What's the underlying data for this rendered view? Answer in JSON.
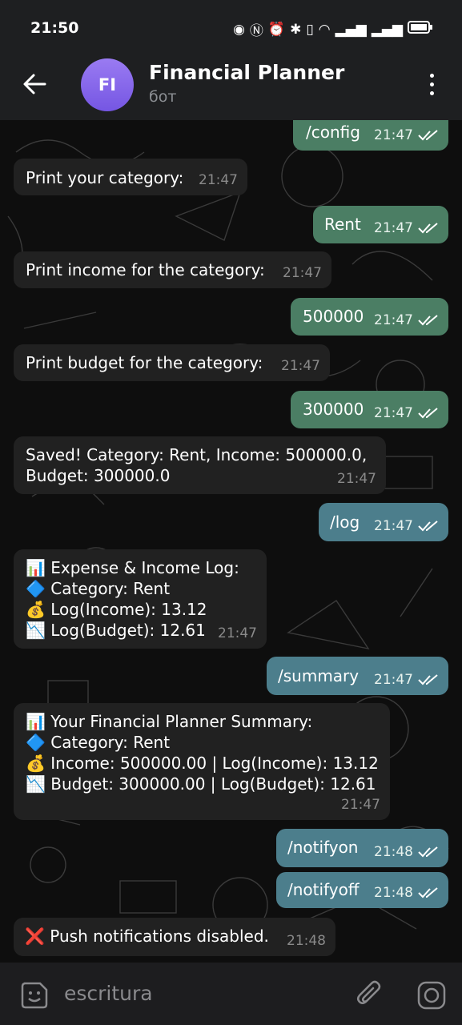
{
  "status_bar": {
    "time": "21:50"
  },
  "header": {
    "avatar_initials": "FI",
    "title": "Financial Planner",
    "subtitle": "бот"
  },
  "messages": [
    {
      "text": "/config",
      "time": "21:47"
    },
    {
      "text": "Print your category:",
      "time": "21:47"
    },
    {
      "text": "Rent",
      "time": "21:47"
    },
    {
      "text": "Print income for the category:",
      "time": "21:47"
    },
    {
      "text": "500000",
      "time": "21:47"
    },
    {
      "text": "Print budget for the category:",
      "time": "21:47"
    },
    {
      "text": "300000",
      "time": "21:47"
    },
    {
      "text": "Saved! Category: Rent, Income: 500000.0,\nBudget: 300000.0",
      "time": "21:47"
    },
    {
      "text": "/log",
      "time": "21:47"
    },
    {
      "text": "📊 Expense & Income Log:\n🔷 Category: Rent\n💰 Log(Income): 13.12\n📉 Log(Budget): 12.61",
      "time": "21:47"
    },
    {
      "text": "/summary",
      "time": "21:47"
    },
    {
      "text": "📊 Your Financial Planner Summary:\n🔷 Category: Rent\n💰 Income: 500000.00 | Log(Income): 13.12\n📉 Budget: 300000.00 | Log(Budget): 12.61",
      "time": "21:47"
    },
    {
      "text": "/notifyon",
      "time": "21:48"
    },
    {
      "text": "/notifyoff",
      "time": "21:48"
    },
    {
      "text": "❌ Push notifications disabled.",
      "time": "21:48"
    }
  ],
  "composer": {
    "placeholder": "escritura"
  },
  "colors": {
    "outgoing_green": "#4b7e64",
    "outgoing_blue": "#4c7e8c",
    "incoming": "#212121",
    "avatar": "#8a6cf0"
  }
}
